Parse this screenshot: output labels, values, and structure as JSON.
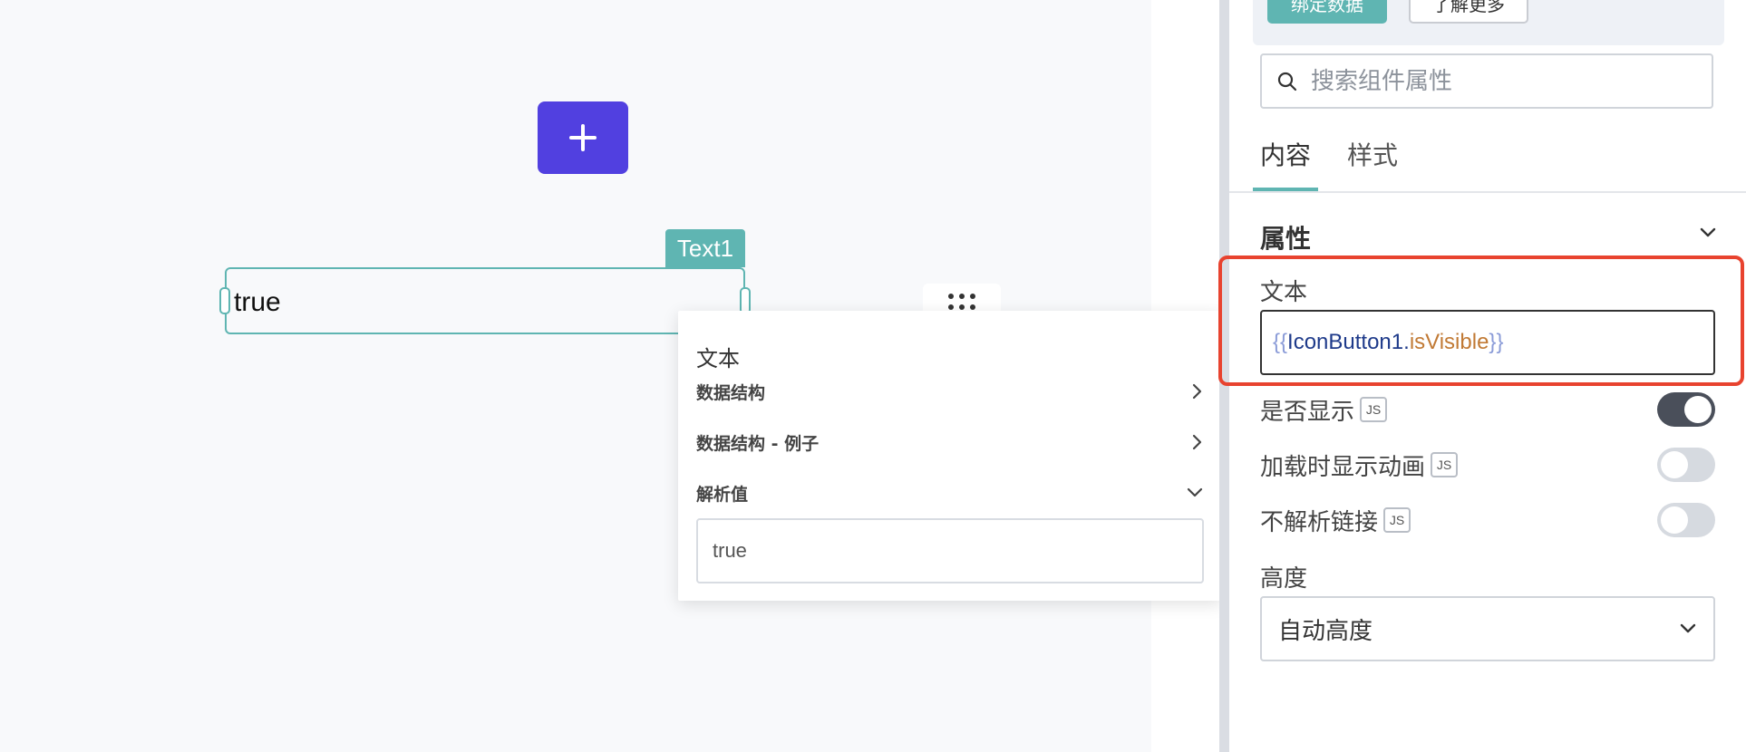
{
  "canvas": {
    "icon_button": {
      "icon": "plus-icon"
    },
    "text_widget": {
      "name_tag": "Text1",
      "value": "true"
    }
  },
  "eval_popup": {
    "title": "文本",
    "rows": [
      {
        "label": "数据结构",
        "icon": "chevron-right-icon"
      },
      {
        "label": "数据结构 - 例子",
        "icon": "chevron-right-icon"
      },
      {
        "label": "解析值",
        "icon": "chevron-down-icon"
      }
    ],
    "evaluated_value": "true"
  },
  "property_pane": {
    "bind_data_label": "绑定数据",
    "learn_more_label": "了解更多",
    "search": {
      "placeholder": "搜索组件属性"
    },
    "tabs": [
      {
        "label": "内容",
        "active": true
      },
      {
        "label": "样式",
        "active": false
      }
    ],
    "section_title": "属性",
    "text_field": {
      "label": "文本",
      "binding": {
        "open": "{{",
        "object": "IconButton1",
        "dot": ".",
        "property": "isVisible",
        "close": "}}"
      }
    },
    "toggles": [
      {
        "label": "是否显示",
        "js_badge": "JS",
        "on": true
      },
      {
        "label": "加载时显示动画",
        "js_badge": "JS",
        "on": false
      },
      {
        "label": "不解析链接",
        "js_badge": "JS",
        "on": false
      }
    ],
    "height": {
      "label": "高度",
      "value": "自动高度"
    }
  },
  "colors": {
    "accent_teal": "#5fb5b2",
    "icon_button_purple": "#5140e0",
    "highlight_red": "#e8432f"
  }
}
